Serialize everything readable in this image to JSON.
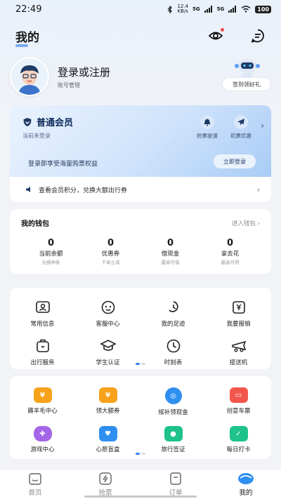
{
  "status": {
    "time": "22:49",
    "net_speed": "12.4",
    "net_unit": "KB/s",
    "signal1": "5G",
    "signal2": "5G",
    "battery": "100"
  },
  "header": {
    "title": "我的"
  },
  "profile": {
    "login_title": "登录或注册",
    "login_sub": "账号管理",
    "sign_in_reward": "签到领好礼"
  },
  "member": {
    "title": "普通会员",
    "subtitle": "当前未登录",
    "benefits": [
      {
        "label": "抢票提速",
        "icon": "bell-icon"
      },
      {
        "label": "机票优惠",
        "icon": "plane-icon"
      }
    ],
    "promo": "登录即享受海量购票权益",
    "login_button": "立即登录",
    "points_text": "查看会员积分，兑换大额出行券"
  },
  "wallet": {
    "title": "我的钱包",
    "link": "进入钱包",
    "items": [
      {
        "value": "0",
        "label": "当前余额",
        "sub": "兑换神券"
      },
      {
        "value": "0",
        "label": "优惠券",
        "sub": "下单立减"
      },
      {
        "value": "0",
        "label": "借现金",
        "sub": "最高可借"
      },
      {
        "value": "0",
        "label": "拿去花",
        "sub": "最高可得"
      }
    ]
  },
  "services": [
    {
      "label": "常用信息",
      "icon": "id-card-icon"
    },
    {
      "label": "客服中心",
      "icon": "service-icon"
    },
    {
      "label": "我的足迹",
      "icon": "footprint-icon"
    },
    {
      "label": "我要报销",
      "icon": "reimburse-icon"
    },
    {
      "label": "出行服务",
      "icon": "travel-service-icon"
    },
    {
      "label": "学生认证",
      "icon": "graduation-cap-icon"
    },
    {
      "label": "时刻表",
      "icon": "clock-icon"
    },
    {
      "label": "接送机",
      "icon": "airport-car-icon"
    }
  ],
  "activities": [
    {
      "label": "薅羊毛中心",
      "icon": "coupon-icon",
      "color": "#f7a21b"
    },
    {
      "label": "领大额券",
      "icon": "gift-coupon-icon",
      "color": "#f7a21b"
    },
    {
      "label": "候补领现金",
      "icon": "cash-icon",
      "color": "#2f8ff0"
    },
    {
      "label": "创意车票",
      "icon": "ticket-icon",
      "color": "#f2574d"
    },
    {
      "label": "游戏中心",
      "icon": "gamepad-icon",
      "color": "#a466e8"
    },
    {
      "label": "心愿盲盒",
      "icon": "blind-box-icon",
      "color": "#2f8ff0"
    },
    {
      "label": "旅行签证",
      "icon": "visa-icon",
      "color": "#1ec28b"
    },
    {
      "label": "每日打卡",
      "icon": "check-in-icon",
      "color": "#1ec28b"
    }
  ],
  "nav": [
    {
      "label": "首页",
      "icon": "home-icon",
      "active": false
    },
    {
      "label": "抢票",
      "icon": "lightning-icon",
      "active": false
    },
    {
      "label": "订单",
      "icon": "order-icon",
      "active": false
    },
    {
      "label": "我的",
      "icon": "profile-icon",
      "active": true
    }
  ]
}
